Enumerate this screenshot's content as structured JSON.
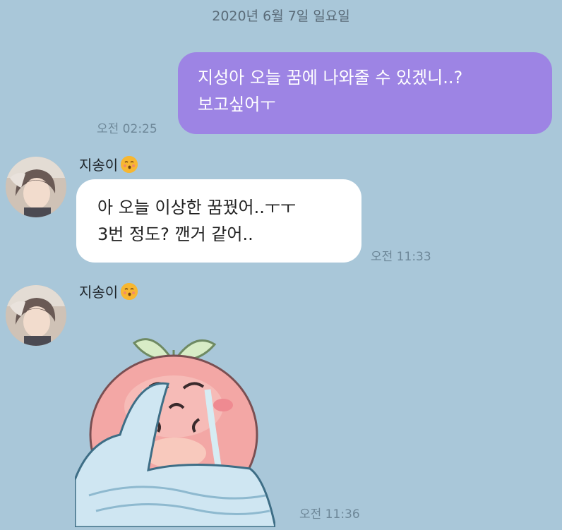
{
  "date_divider": "2020년 6월 7일 일요일",
  "messages": [
    {
      "direction": "out",
      "lines": [
        "지성아 오늘 꿈에 나와줄 수 있겠니..?",
        "보고싶어ㅜ"
      ],
      "time": "오전 02:25"
    },
    {
      "direction": "in",
      "sender": "지송이",
      "sender_emoji": "kissing-face-emoji",
      "lines": [
        "아 오늘 이상한 꿈꿨어..ㅜㅜ",
        "3번 정도? 깬거 같어.."
      ],
      "time": "오전 11:33"
    },
    {
      "direction": "in",
      "sender": "지송이",
      "sender_emoji": "kissing-face-emoji",
      "sticker": "crying-peach-sticker",
      "time": "오전 11:36"
    }
  ],
  "colors": {
    "background": "#a9c7d9",
    "outgoing_bubble": "#9d84e4",
    "incoming_bubble": "#ffffff"
  }
}
